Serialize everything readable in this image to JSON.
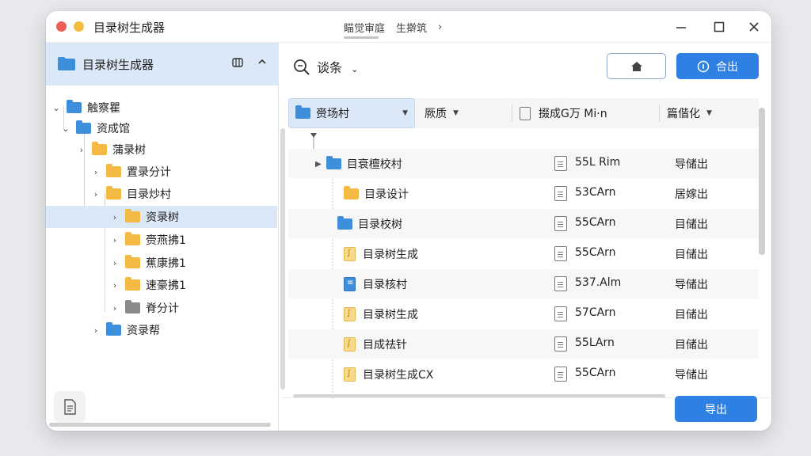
{
  "window": {
    "title": "目录树生成器"
  },
  "breadcrumb": {
    "items": [
      "瞄觉审庭",
      "生擀筑"
    ],
    "chevron": "›"
  },
  "sidebar": {
    "header_title": "目录树生成器",
    "items": [
      {
        "label": "触察瞿",
        "folder": "blue",
        "chev": "⌄"
      },
      {
        "label": "资成馆",
        "folder": "blue",
        "chev": "⌄"
      },
      {
        "label": "蒲录树",
        "folder": "yellow",
        "chev": "›"
      },
      {
        "label": "置录分计",
        "folder": "yellow",
        "chev": "›"
      },
      {
        "label": "目录炒村",
        "folder": "yellow",
        "chev": "›"
      },
      {
        "label": "资录树",
        "folder": "yellow",
        "chev": "›",
        "selected": true
      },
      {
        "label": "赍燕拂1",
        "folder": "yellow",
        "chev": "›"
      },
      {
        "label": "蕉康拂1",
        "folder": "yellow",
        "chev": "›"
      },
      {
        "label": "速豪拂1",
        "folder": "yellow",
        "chev": "›"
      },
      {
        "label": "脊分计",
        "folder": "gray",
        "chev": "›"
      },
      {
        "label": "资录帮",
        "folder": "blue",
        "chev": "›"
      }
    ]
  },
  "toolbar": {
    "search_label": "谈条",
    "export_label": "合出"
  },
  "columns": [
    "赍场村",
    "厥质",
    "掇成G万 Mi·n",
    "篇偕化"
  ],
  "rows": [
    {
      "name": "目衰檀校村",
      "icon": "folder-blue",
      "size": "55L Rim",
      "status": "导储出"
    },
    {
      "name": "目录设计",
      "icon": "folder-yellow",
      "size": "53CArn",
      "status": "居嫁出"
    },
    {
      "name": "目录校树",
      "icon": "folder-blue",
      "size": "55CArn",
      "status": "目储出"
    },
    {
      "name": "目录树生成",
      "icon": "file-yellow",
      "size": "55CArn",
      "status": "目储出"
    },
    {
      "name": "目录核村",
      "icon": "file-blue",
      "size": "537.Alm",
      "status": "导储出"
    },
    {
      "name": "目录树生成",
      "icon": "file-yellow",
      "size": "57CArn",
      "status": "目储出"
    },
    {
      "name": "目成祛针",
      "icon": "file-yellow",
      "size": "55LArn",
      "status": "目储出"
    },
    {
      "name": "目录树生成CX",
      "icon": "file-yellow",
      "size": "55CArn",
      "status": "导储出"
    }
  ],
  "footer": {
    "export_label": "导出"
  },
  "colors": {
    "accent": "#2f80e3",
    "selection": "#dbe8f8",
    "folder_blue": "#3d8fdc",
    "folder_yellow": "#f4b942"
  }
}
